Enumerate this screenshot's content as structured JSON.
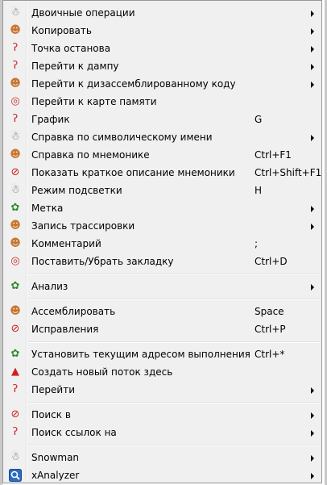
{
  "menu": {
    "items": [
      {
        "label": "Двоичные операции",
        "shortcut": "",
        "icon": "snowman-icon",
        "glyph": "☃",
        "submenu": true
      },
      {
        "label": "Копировать",
        "shortcut": "",
        "icon": "gingerbread-icon",
        "glyph": "☻",
        "submenu": true
      },
      {
        "label": "Точка останова",
        "shortcut": "",
        "icon": "candy-cane-icon",
        "glyph": "ʔ",
        "submenu": true
      },
      {
        "label": "Перейти к дампу",
        "shortcut": "",
        "icon": "candy-cane-icon",
        "glyph": "ʔ",
        "submenu": true
      },
      {
        "label": "Перейти к дизассемблированному коду",
        "shortcut": "",
        "icon": "gingerbread-icon",
        "glyph": "☻",
        "submenu": true
      },
      {
        "label": "Перейти к карте памяти",
        "shortcut": "",
        "icon": "ornament-icon",
        "glyph": "◎",
        "submenu": false
      },
      {
        "label": "График",
        "shortcut": "G",
        "icon": "candy-cane-icon",
        "glyph": "ʔ",
        "submenu": false
      },
      {
        "label": "Справка по символическому имени",
        "shortcut": "",
        "icon": "snowman-icon",
        "glyph": "☃",
        "submenu": true
      },
      {
        "label": "Справка по мнемонике",
        "shortcut": "Ctrl+F1",
        "icon": "gingerbread-icon",
        "glyph": "☻",
        "submenu": false
      },
      {
        "label": "Показать краткое описание мнемоники",
        "shortcut": "Ctrl+Shift+F1",
        "icon": "no-entry-icon",
        "glyph": "⊘",
        "submenu": false
      },
      {
        "label": "Режим подсветки",
        "shortcut": "H",
        "icon": "snowman-icon",
        "glyph": "☃",
        "submenu": false
      },
      {
        "label": "Метка",
        "shortcut": "",
        "icon": "holly-icon",
        "glyph": "✿",
        "submenu": true
      },
      {
        "label": "Запись трассировки",
        "shortcut": "",
        "icon": "gingerbread-icon",
        "glyph": "☻",
        "submenu": true
      },
      {
        "label": "Комментарий",
        "shortcut": ";",
        "icon": "gingerbread-icon",
        "glyph": "☻",
        "submenu": false
      },
      {
        "label": "Поставить/Убрать закладку",
        "shortcut": "Ctrl+D",
        "icon": "ornament-icon",
        "glyph": "◎",
        "submenu": false
      },
      {
        "label": "Анализ",
        "shortcut": "",
        "icon": "holly-icon",
        "glyph": "✿",
        "submenu": true
      },
      {
        "label": "Ассемблировать",
        "shortcut": "Space",
        "icon": "gingerbread-icon",
        "glyph": "☻",
        "submenu": false
      },
      {
        "label": "Исправления",
        "shortcut": "Ctrl+P",
        "icon": "no-entry-icon",
        "glyph": "⊘",
        "submenu": false
      },
      {
        "label": "Установить текущим адресом выполнения",
        "shortcut": "Ctrl+*",
        "icon": "holly-icon",
        "glyph": "✿",
        "submenu": false
      },
      {
        "label": "Создать новый поток здесь",
        "shortcut": "",
        "icon": "santa-hat-icon",
        "glyph": "▲",
        "submenu": false
      },
      {
        "label": "Перейти",
        "shortcut": "",
        "icon": "candy-cane-icon",
        "glyph": "ʔ",
        "submenu": true
      },
      {
        "label": "Поиск в",
        "shortcut": "",
        "icon": "no-entry-icon",
        "glyph": "⊘",
        "submenu": true
      },
      {
        "label": "Поиск ссылок на",
        "shortcut": "",
        "icon": "candy-cane-icon",
        "glyph": "ʔ",
        "submenu": true
      },
      {
        "label": "Snowman",
        "shortcut": "",
        "icon": "snowman-icon",
        "glyph": "☃",
        "submenu": true
      },
      {
        "label": "xAnalyzer",
        "shortcut": "",
        "icon": "magnifier-icon",
        "glyph": "",
        "submenu": true
      }
    ]
  }
}
